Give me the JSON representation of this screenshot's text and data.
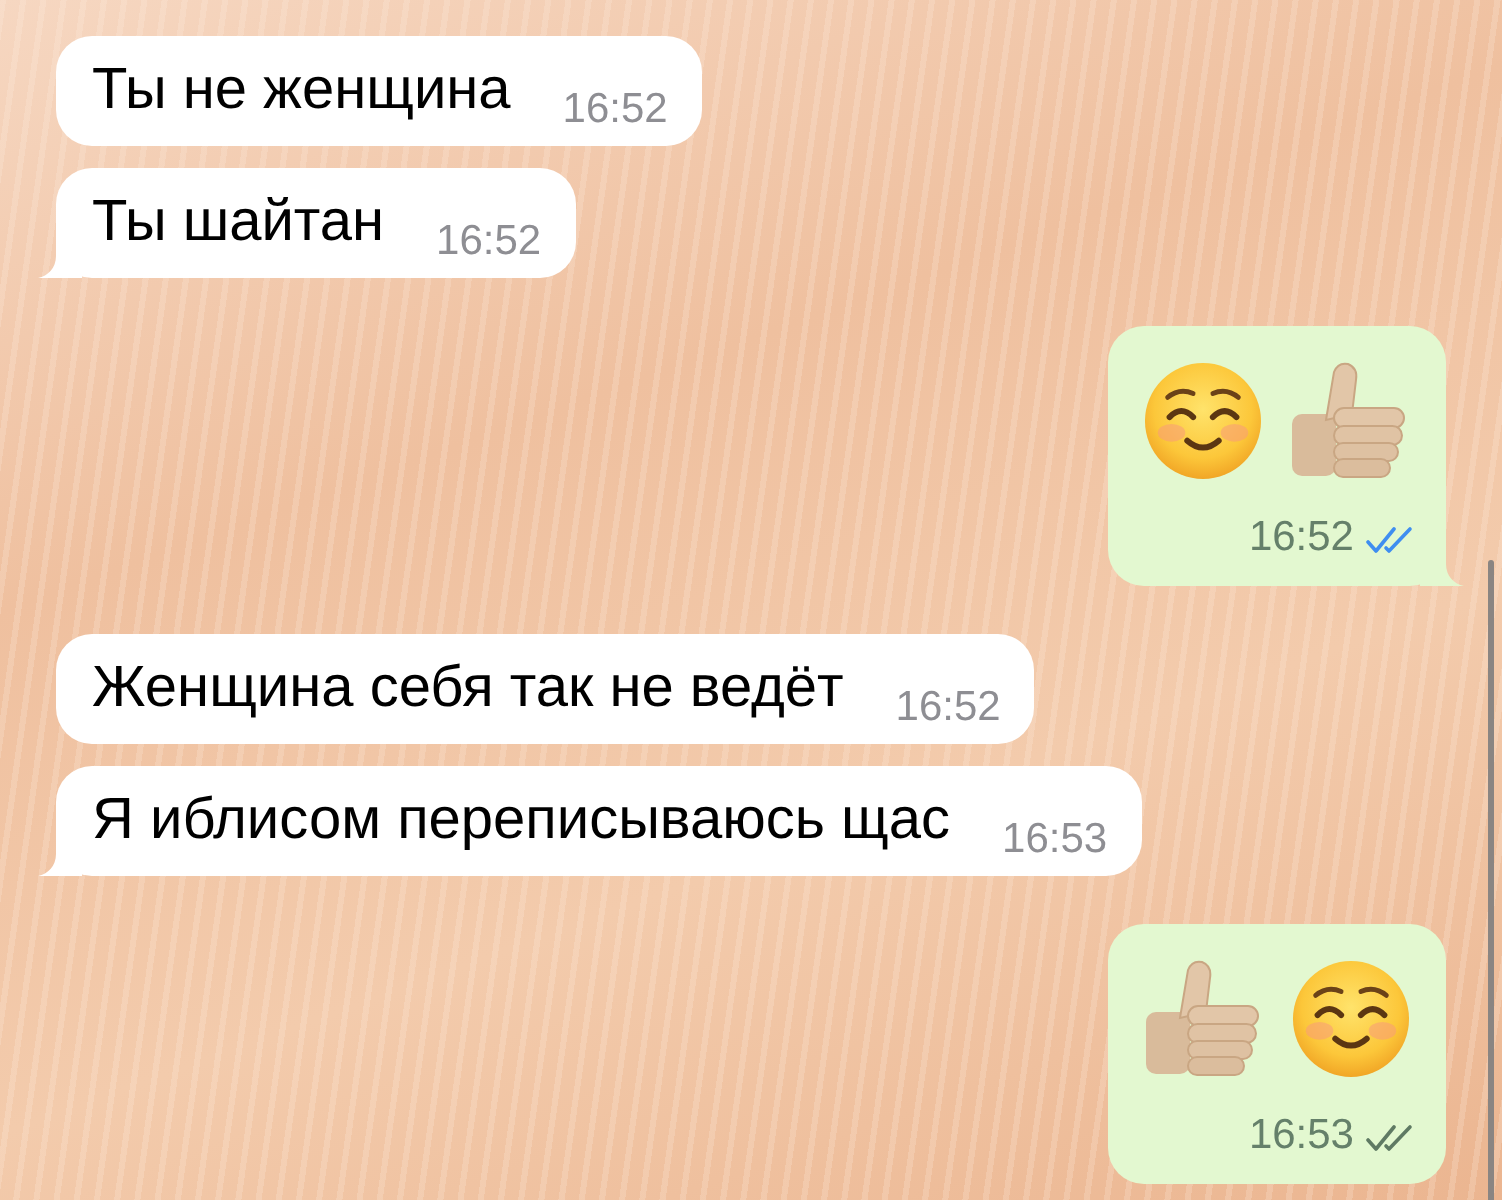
{
  "messages": [
    {
      "outgoing": false,
      "kind": "text",
      "text": "Ты не женщина",
      "time": "16:52",
      "tail": false
    },
    {
      "outgoing": false,
      "kind": "text",
      "text": "Ты шайтан",
      "time": "16:52",
      "tail": true
    },
    {
      "outgoing": true,
      "kind": "emoji",
      "emojis": [
        {
          "kind": "smiling_face"
        },
        {
          "kind": "thumbs_up"
        }
      ],
      "time": "16:52",
      "read": true,
      "tail": true
    },
    {
      "outgoing": false,
      "kind": "text",
      "text": "Женщина себя так не ведёт",
      "time": "16:52",
      "tail": false
    },
    {
      "outgoing": false,
      "kind": "text",
      "text": "Я иблисом переписываюсь щас",
      "time": "16:53",
      "tail": true
    },
    {
      "outgoing": true,
      "kind": "emoji",
      "emojis": [
        {
          "kind": "thumbs_up"
        },
        {
          "kind": "smiling_face"
        }
      ],
      "time": "16:53",
      "read": false,
      "tail": false
    }
  ]
}
